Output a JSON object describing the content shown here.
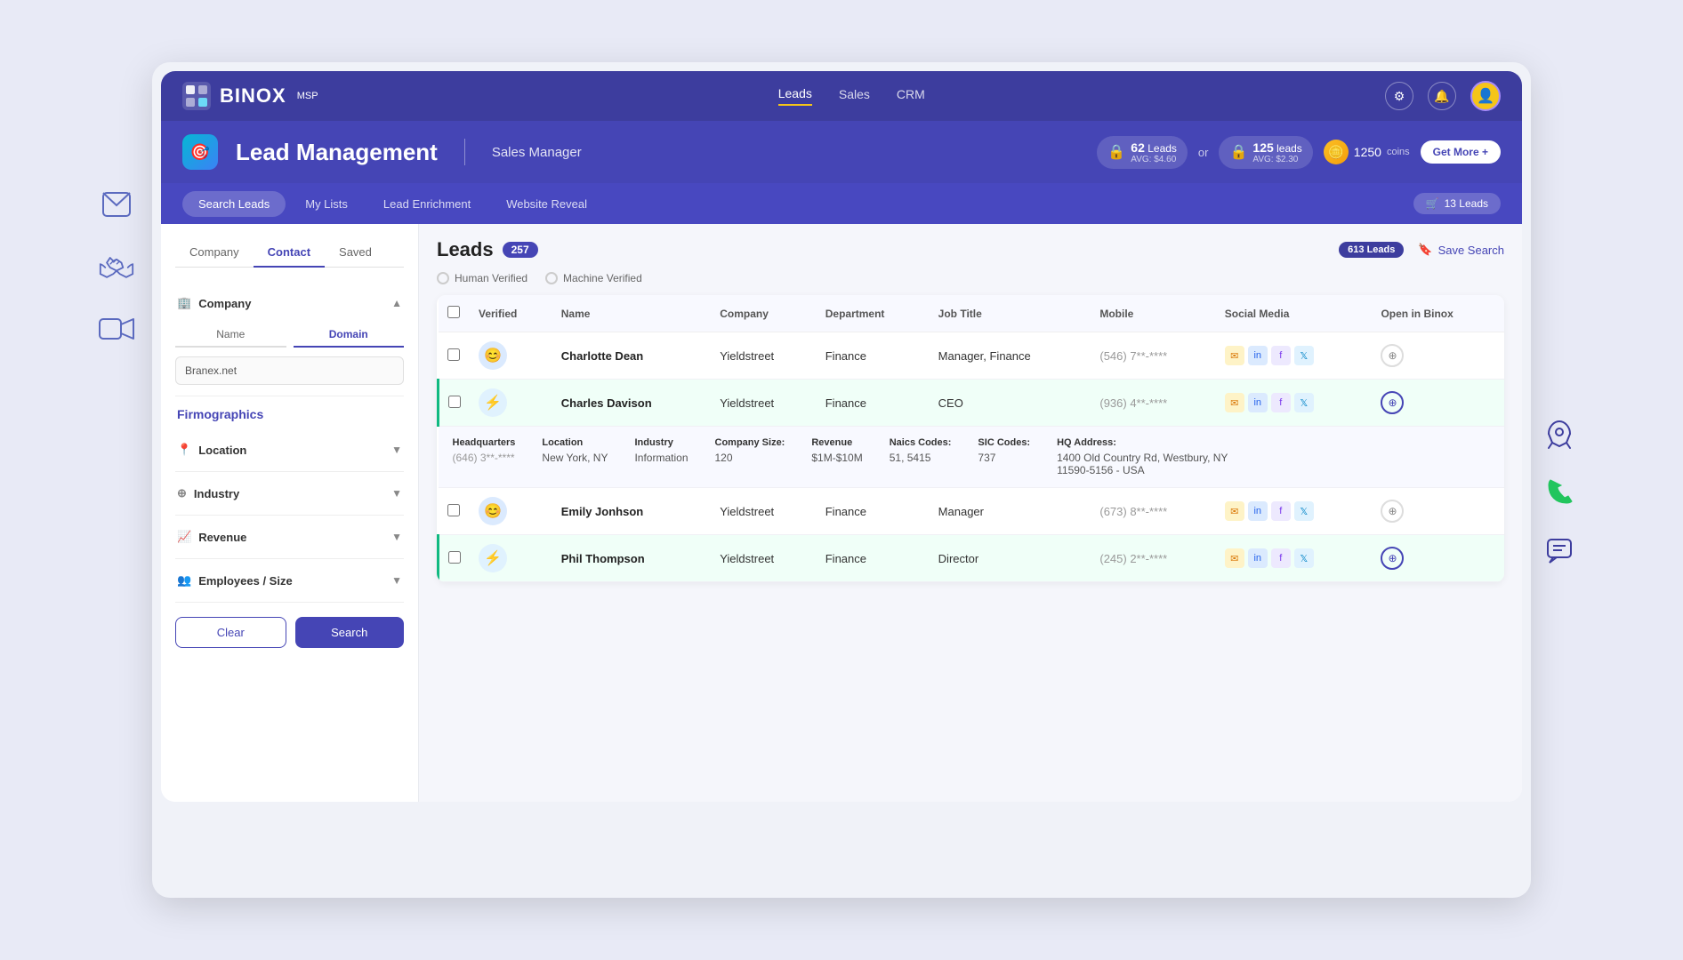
{
  "app": {
    "name": "BINOX",
    "msp": "MSP",
    "page_title": "Lead Management",
    "sub_title": "Sales Manager"
  },
  "nav": {
    "links": [
      "Leads",
      "Sales",
      "CRM"
    ],
    "active": "Leads"
  },
  "header": {
    "leads_plan": "62",
    "leads_plan_label": "Leads",
    "leads_plan_avg": "AVG: $4.60",
    "leads_plan2": "125",
    "leads_plan2_label": "leads",
    "leads_plan2_avg": "AVG: $2.30",
    "coins": "1250",
    "coins_label": "coins",
    "get_more_label": "Get More +"
  },
  "tabs": {
    "items": [
      "Search Leads",
      "My Lists",
      "Lead Enrichment",
      "Website Reveal"
    ],
    "active": "Search Leads",
    "cart_label": "13 Leads"
  },
  "sidebar": {
    "tabs": [
      "Company",
      "Contact",
      "Saved"
    ],
    "active_tab": "Contact",
    "company_section": "Company",
    "name_tab": "Name",
    "domain_tab": "Domain",
    "domain_value": "Branex.net",
    "firmographics_label": "Firmographics",
    "location_label": "Location",
    "industry_label": "Industry",
    "revenue_label": "Revenue",
    "employees_label": "Employees / Size",
    "clear_btn": "Clear",
    "search_btn": "Search"
  },
  "leads": {
    "title": "Leads",
    "count": "257",
    "total_count": "613 Leads",
    "save_search": "Save Search",
    "verified": {
      "human": "Human Verified",
      "machine": "Machine Verified"
    },
    "columns": [
      "Verified",
      "Name",
      "Company",
      "Department",
      "Job Title",
      "Mobile",
      "Social Media",
      "Open in Binox"
    ],
    "rows": [
      {
        "id": 1,
        "verified_type": "human",
        "name": "Charlotte Dean",
        "company": "Yieldstreet",
        "department": "Finance",
        "job_title": "Manager, Finance",
        "mobile": "(546) 7**-****",
        "highlighted": false,
        "expanded": false
      },
      {
        "id": 2,
        "verified_type": "machine",
        "name": "Charles Davison",
        "company": "Yieldstreet",
        "department": "Finance",
        "job_title": "CEO",
        "mobile": "(936) 4**-****",
        "highlighted": true,
        "expanded": true,
        "details": {
          "headquarters": "(646) 3**-****",
          "location": "New York, NY",
          "industry": "Information",
          "company_size": "120",
          "revenue": "$1M-$10M",
          "naics_codes": "51, 5415",
          "sic_codes": "737",
          "hq_address": "1400 Old Country Rd, Westbury, NY",
          "hq_address2": "11590-5156 - USA"
        }
      },
      {
        "id": 3,
        "verified_type": "human",
        "name": "Emily Jonhson",
        "company": "Yieldstreet",
        "department": "Finance",
        "job_title": "Manager",
        "mobile": "(673) 8**-****",
        "highlighted": false,
        "expanded": false
      },
      {
        "id": 4,
        "verified_type": "machine",
        "name": "Phil Thompson",
        "company": "Yieldstreet",
        "department": "Finance",
        "job_title": "Director",
        "mobile": "(245) 2**-****",
        "highlighted": true,
        "expanded": false
      }
    ]
  }
}
